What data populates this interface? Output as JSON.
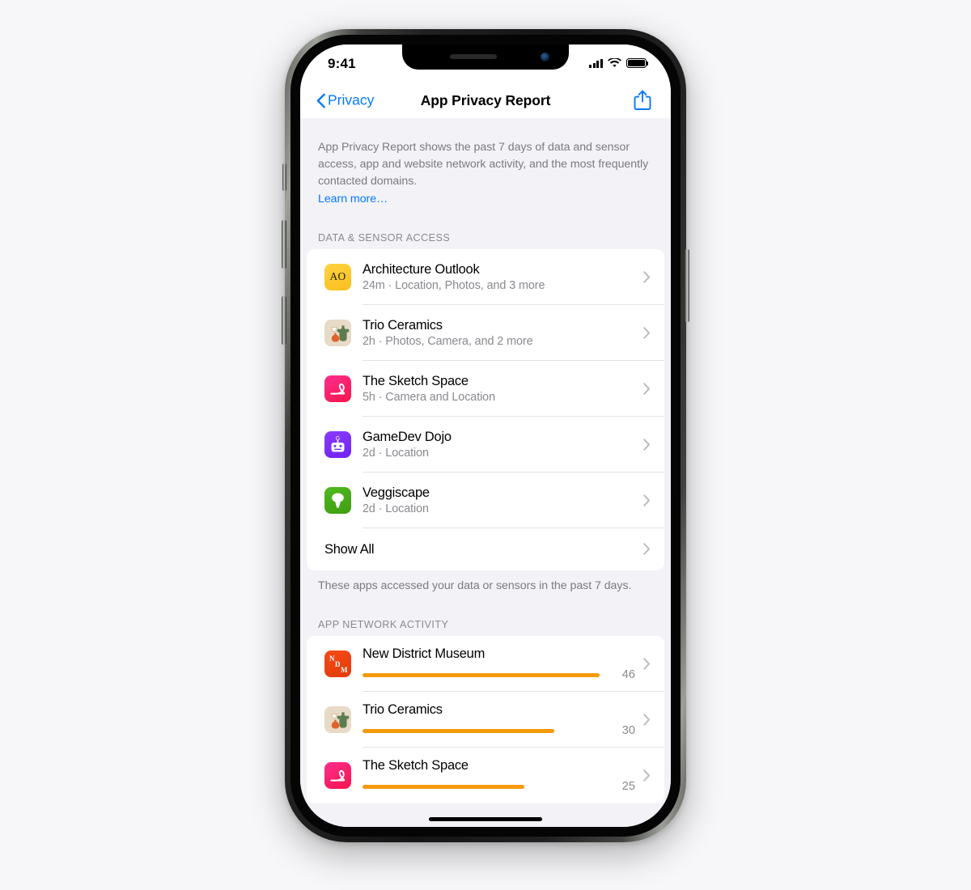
{
  "status_bar": {
    "time": "9:41",
    "signal_icon": "cellular-signal-icon",
    "wifi_icon": "wifi-icon",
    "battery_icon": "battery-full-icon"
  },
  "nav_bar": {
    "back_label": "Privacy",
    "back_icon": "chevron-left-icon",
    "title": "App Privacy Report",
    "share_icon": "share-icon"
  },
  "intro": {
    "text": "App Privacy Report shows the past 7 days of data and sensor access, app and website network activity, and the most frequently contacted domains.",
    "link_label": "Learn more…"
  },
  "sections": [
    {
      "header": "DATA & SENSOR ACCESS",
      "footnote": "These apps accessed your data or sensors in the past 7 days.",
      "rows": [
        {
          "name": "Architecture Outlook",
          "detail": "24m · Location, Photos, and 3 more",
          "icon": "architecture-outlook-app-icon",
          "icon_text": "AO"
        },
        {
          "name": "Trio Ceramics",
          "detail": "2h · Photos, Camera, and 2 more",
          "icon": "trio-ceramics-app-icon"
        },
        {
          "name": "The Sketch Space",
          "detail": "5h · Camera and Location",
          "icon": "the-sketch-space-app-icon"
        },
        {
          "name": "GameDev Dojo",
          "detail": "2d · Location",
          "icon": "gamedev-dojo-app-icon"
        },
        {
          "name": "Veggiscape",
          "detail": "2d · Location",
          "icon": "veggiscape-app-icon"
        }
      ],
      "show_all_label": "Show All"
    },
    {
      "header": "APP NETWORK ACTIVITY",
      "rows": [
        {
          "name": "New District Museum",
          "value": "46",
          "bar_pct": 94,
          "icon": "new-district-museum-app-icon"
        },
        {
          "name": "Trio Ceramics",
          "value": "30",
          "bar_pct": 76,
          "icon": "trio-ceramics-app-icon"
        },
        {
          "name": "The Sketch Space",
          "value": "25",
          "bar_pct": 64,
          "icon": "the-sketch-space-app-icon"
        }
      ]
    }
  ],
  "colors": {
    "accent_blue": "#037aff",
    "bar_orange": "#f59a0c",
    "page_background": "#f2f2f7",
    "card_background": "#ffffff",
    "secondary_text": "#8a8a8f"
  }
}
